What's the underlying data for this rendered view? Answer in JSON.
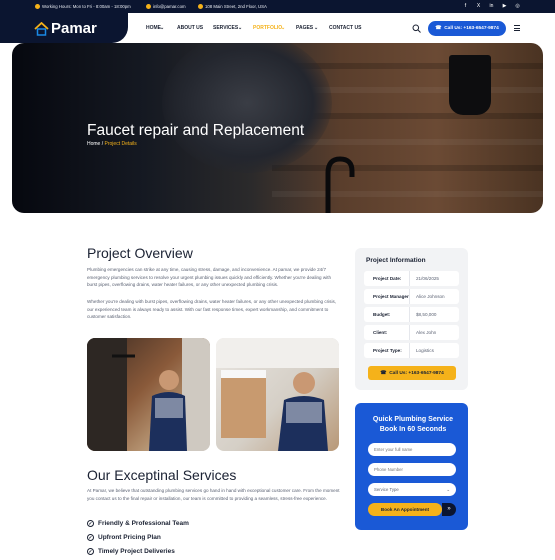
{
  "topbar": {
    "hours": "Working Hours: Mon to Fri - 8:00am - 18:00pm",
    "email": "info@pamar.com",
    "address": "108 Main Street, 2nd Floor, USA",
    "social": [
      "f",
      "X",
      "in",
      "▶",
      "◎"
    ]
  },
  "header": {
    "logo": "Pamar",
    "nav": [
      "HOME",
      "ABOUT US",
      "SERVICES",
      "PORTFOLIO",
      "PAGES",
      "CONTACT US"
    ],
    "call_label": "Call Us: +163-6547-9874",
    "colors": {
      "dark": "#0b1530",
      "primary": "#1a59d6",
      "accent": "#f5b21a"
    }
  },
  "hero": {
    "title": "Faucet repair and Replacement",
    "breadcrumb_home": "Home",
    "breadcrumb_sep": "/",
    "breadcrumb_current": "Project Details"
  },
  "overview": {
    "heading": "Project Overview",
    "para1": "Plumbing emergencies can strike at any time, causing stress, damage, and inconvenience. At pamar, we provide 24/7 emergency plumbing services to resolve your urgent plumbing issues quickly and efficiently. Whether you're dealing with burst pipes, overflowing drains, water heater failures, or any other unexpected plumbing crisis.",
    "para2": "Whether you're dealing with burst pipes, overflowing drains, water heater failures, or any other unexpected plumbing crisis, our experienced team is always ready to assist. With our fast response times, expert workmanship, and commitment to customer satisfaction."
  },
  "services": {
    "heading": "Our Exceptinal Services",
    "para": "At Pamar, we believe that outstanding plumbing services go hand in hand with exceptional customer care. From the moment you contact us to the final repair or installation, our team is committed to providing a seamless, stress-free experience.",
    "checks": [
      "Friendly & Professional Team",
      "Upfront Pricing Plan",
      "Timely Project Deliveries"
    ]
  },
  "project_info": {
    "title": "Project Information",
    "rows": [
      {
        "label": "Project Date:",
        "value": "21/06/2025"
      },
      {
        "label": "Project Manager:",
        "value": "Alice Johnson"
      },
      {
        "label": "Budget:",
        "value": "$8,50,000"
      },
      {
        "label": "Client:",
        "value": "Alex John"
      },
      {
        "label": "Project Type:",
        "value": "Logistics"
      }
    ],
    "call_label": "Call Us: +163-6547-9874"
  },
  "quote": {
    "title": "Quick Plumbing Service Book In 60 Seconds",
    "name_placeholder": "Enter your full name",
    "phone_placeholder": "Phone Number",
    "service_placeholder": "Service Type",
    "button_label": "Book An Appointment",
    "arrow": "»"
  }
}
